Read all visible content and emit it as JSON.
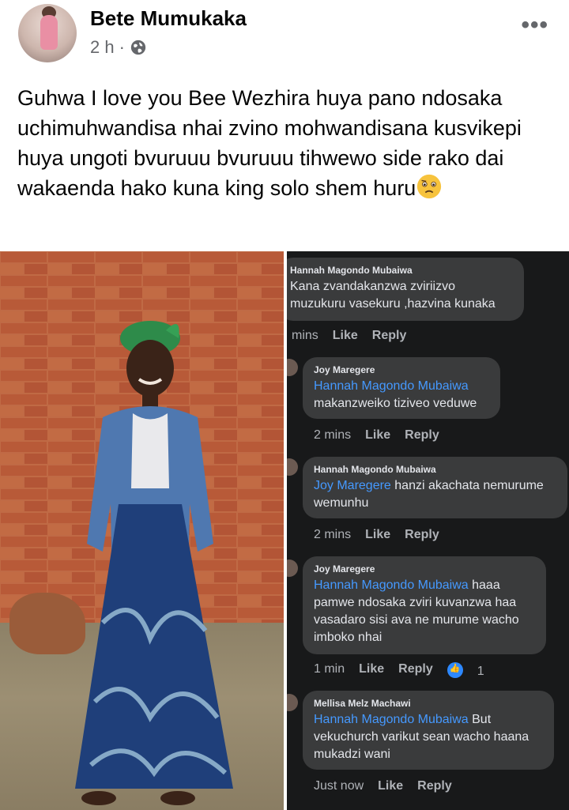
{
  "post": {
    "author": "Bete Mumukaka",
    "time": "2 h",
    "separator": "·",
    "privacy_icon": "globe-icon",
    "more_icon": "more-options-icon",
    "text": "Guhwa I love you Bee Wezhira huya pano ndosaka uchimuhwandisa nhai zvino mohwandisana kusvikepi huya ungoti bvuruuu bvuruuu tihwewo side rako dai wakaenda hako kuna king solo shem huru",
    "emoji": "frowning-face-emoji"
  },
  "comments": [
    {
      "author": "Hannah Magondo Mubaiwa",
      "mention": "",
      "body": "Kana zvandakanzwa zviriizvo muzukuru vasekuru ,hazvina kunaka",
      "time": "mins",
      "like": "Like",
      "reply": "Reply",
      "reactions": ""
    },
    {
      "author": "Joy Maregere",
      "mention": "Hannah Magondo Mubaiwa",
      "body": "makanzweiko tiziveo veduwe",
      "time": "2 mins",
      "like": "Like",
      "reply": "Reply",
      "reactions": ""
    },
    {
      "author": "Hannah Magondo Mubaiwa",
      "mention": "Joy Maregere",
      "body": " hanzi akachata nemurume wemunhu",
      "time": "2 mins",
      "like": "Like",
      "reply": "Reply",
      "reactions": ""
    },
    {
      "author": "Joy Maregere",
      "mention": "Hannah Magondo Mubaiwa",
      "body": " haaa pamwe ndosaka zviri kuvanzwa haa vasadaro sisi ava ne murume wacho imboko nhai",
      "time": "1 min",
      "like": "Like",
      "reply": "Reply",
      "reactions": "1"
    },
    {
      "author": "Mellisa Melz Machawi",
      "mention": "Hannah Magondo Mubaiwa",
      "body": " But vekuchurch varikut sean wacho haana mukadzi wani",
      "time": "Just now",
      "like": "Like",
      "reply": "Reply",
      "reactions": ""
    }
  ]
}
